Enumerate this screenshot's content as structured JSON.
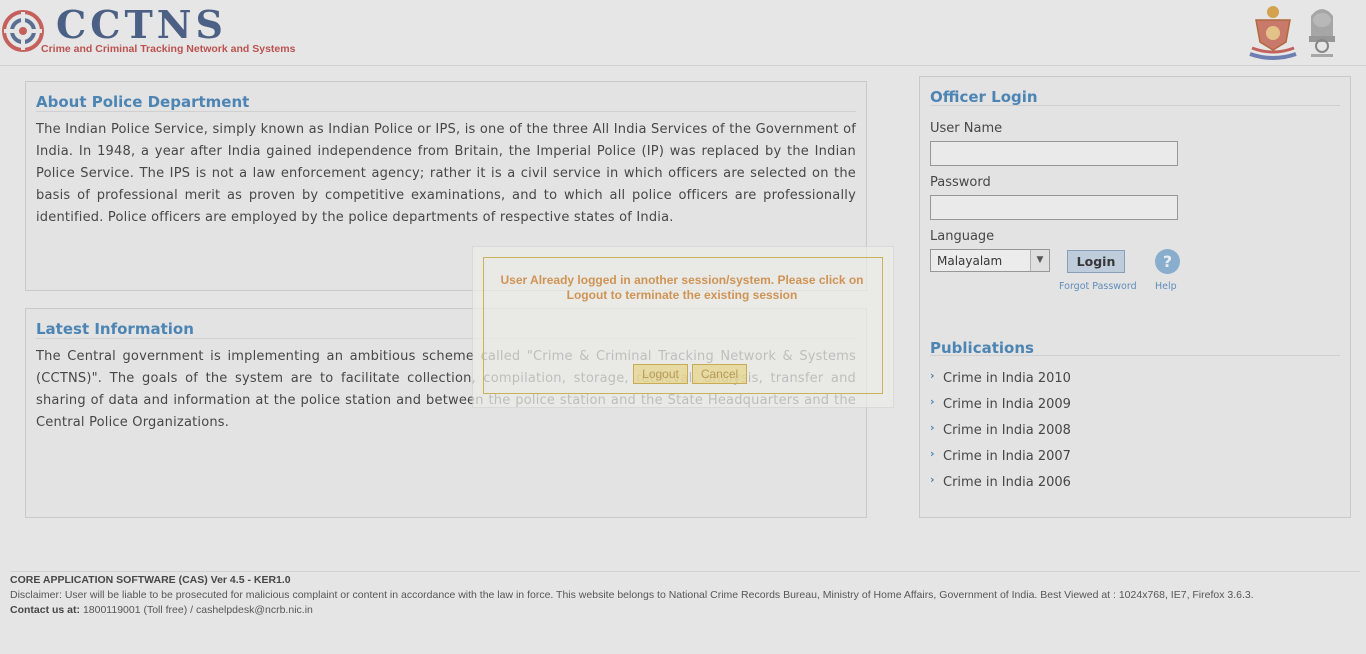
{
  "header": {
    "title": "CCTNS",
    "subtitle": "Crime and Criminal Tracking Network and Systems"
  },
  "about": {
    "title": "About Police Department",
    "body": "The Indian Police Service, simply known as Indian Police or IPS, is one of the three All India Services of the Government of India. In 1948, a year after India gained independence from Britain, the Imperial Police (IP) was replaced by the Indian Police Service. The IPS is not a law enforcement agency; rather it is a civil service in which officers are selected on the basis of professional merit as proven by competitive examinations, and to which all police officers are professionally identified. Police officers are employed by the police departments of respective states of India."
  },
  "latest": {
    "title": "Latest Information",
    "body": "The Central government is implementing an ambitious scheme called \"Crime & Criminal Tracking Network & Systems (CCTNS)\". The goals of the system are to facilitate collection, compilation, storage, retrieval, analysis, transfer and sharing of data and information at the police station and between the police station and the State Headquarters and the Central Police Organizations."
  },
  "login": {
    "title": "Officer Login",
    "username_label": "User Name",
    "username_value": "",
    "password_label": "Password",
    "password_value": "",
    "language_label": "Language",
    "language_selected": "Malayalam",
    "login_button": "Login",
    "help_glyph": "?",
    "forgot_password": "Forgot Password",
    "help": "Help"
  },
  "publications": {
    "title": "Publications",
    "items": [
      "Crime in India 2010",
      "Crime in India 2009",
      "Crime in India 2008",
      "Crime in India 2007",
      "Crime in India 2006"
    ]
  },
  "footer": {
    "version": "CORE APPLICATION SOFTWARE (CAS) Ver 4.5 - KER1.0",
    "disclaimer": "Disclaimer: User will be liable to be prosecuted for malicious complaint or content in accordance with the law in force. This website belongs to National Crime Records Bureau, Ministry of Home Affairs, Government of India. Best Viewed at : 1024x768, IE7, Firefox 3.6.3.",
    "contact_label": "Contact us at:",
    "contact_value": "1800119001 (Toll free) / cashelpdesk@ncrb.nic.in"
  },
  "modal": {
    "message": "User Already logged in another session/system. Please click on Logout to terminate the existing session",
    "logout_button": "Logout",
    "cancel_button": "Cancel"
  },
  "icons": {
    "logo": "cctns-logo-icon",
    "police_emblem": "police-emblem-icon",
    "national_emblem": "national-emblem-icon",
    "help": "help-icon",
    "chevron": "chevron-right-icon"
  }
}
